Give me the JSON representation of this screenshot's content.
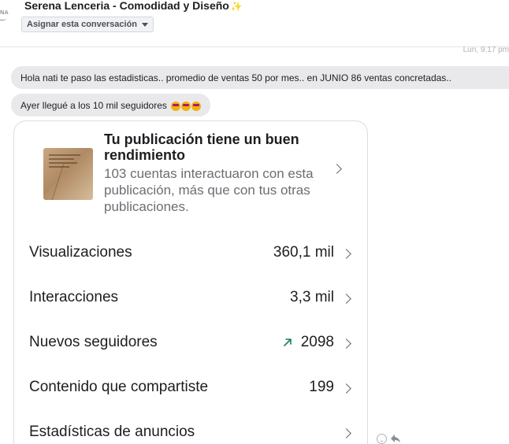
{
  "header": {
    "avatar_text": "NA",
    "title": "Serena Lenceria - Comodidad y Diseño",
    "title_sparkle": "✨",
    "assign_label": "Asignar esta conversación"
  },
  "timestamp": "Lun, 9:17 pm",
  "messages": [
    {
      "text": "Hola nati te paso las estadisticas.. promedio de ventas 50 por mes.. en JUNIO 86 ventas concretadas.."
    },
    {
      "text": "Ayer llegué a los 10 mil seguidores"
    }
  ],
  "insights_card": {
    "title": "Tu publicación tiene un buen rendimiento",
    "description": "103 cuentas interactuaron con esta publicación, más que con tus otras publicaciones.",
    "rows": [
      {
        "label": "Visualizaciones",
        "value": "360,1 mil"
      },
      {
        "label": "Interacciones",
        "value": "3,3 mil"
      },
      {
        "label": "Nuevos seguidores",
        "value": "2098",
        "trend_icon": "trend-up-icon",
        "trend_color": "#1a7f4f"
      },
      {
        "label": "Contenido que compartiste",
        "value": "199"
      },
      {
        "label": "Estadísticas de anuncios",
        "value": ""
      }
    ]
  },
  "colors": {
    "bubble_bg": "#e9e9eb",
    "card_border": "#dbdde1",
    "muted_text": "#6b6e73"
  }
}
